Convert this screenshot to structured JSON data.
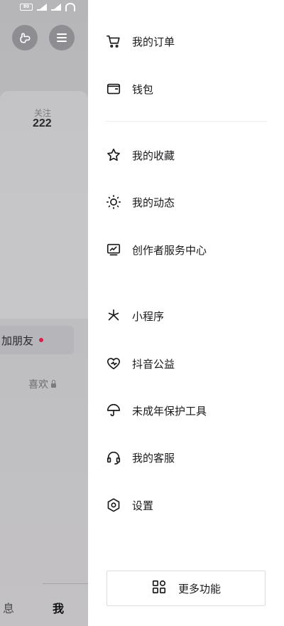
{
  "status_bar": {
    "battery": "80"
  },
  "profile": {
    "follow_label": "关注",
    "follow_count": "222",
    "add_friend": "加朋友",
    "likes": "喜欢"
  },
  "bottom_tabs": {
    "messages_partial": "息",
    "me": "我"
  },
  "drawer": {
    "items": [
      {
        "label": "我的订单",
        "icon": "cart-icon"
      },
      {
        "label": "钱包",
        "icon": "wallet-icon"
      },
      {
        "label": "我的收藏",
        "icon": "star-icon"
      },
      {
        "label": "我的动态",
        "icon": "activity-icon"
      },
      {
        "label": "创作者服务中心",
        "icon": "creator-chart-icon"
      },
      {
        "label": "小程序",
        "icon": "mini-program-icon"
      },
      {
        "label": "抖音公益",
        "icon": "charity-heart-icon"
      },
      {
        "label": "未成年保护工具",
        "icon": "umbrella-icon"
      },
      {
        "label": "我的客服",
        "icon": "headset-icon"
      },
      {
        "label": "设置",
        "icon": "settings-hexagon-icon"
      }
    ],
    "more_label": "更多功能"
  },
  "colors": {
    "overlay_grey": "#bdbdc0",
    "accent_dot": "#d81e4a",
    "drawer_bg": "#ffffff"
  }
}
